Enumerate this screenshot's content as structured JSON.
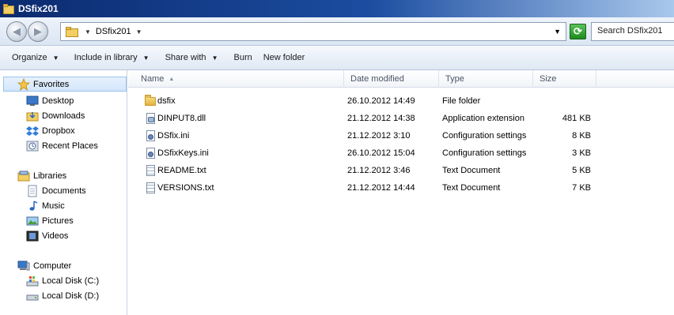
{
  "window": {
    "title": "DSfix201"
  },
  "address": {
    "path": "DSfix201",
    "search_placeholder": "Search DSfix201"
  },
  "toolbar": {
    "organize": "Organize",
    "include_in_library": "Include in library",
    "share_with": "Share with",
    "burn": "Burn",
    "new_folder": "New folder"
  },
  "nav": {
    "favorites": "Favorites",
    "desktop": "Desktop",
    "downloads": "Downloads",
    "dropbox": "Dropbox",
    "recent_places": "Recent Places",
    "libraries": "Libraries",
    "documents": "Documents",
    "music": "Music",
    "pictures": "Pictures",
    "videos": "Videos",
    "computer": "Computer",
    "local_disk_c": "Local Disk (C:)",
    "local_disk_d": "Local Disk (D:)"
  },
  "columns": {
    "name": "Name",
    "date_modified": "Date modified",
    "type": "Type",
    "size": "Size"
  },
  "files": [
    {
      "name": "dsfix",
      "date": "26.10.2012 14:49",
      "type": "File folder",
      "size": "",
      "icon": "folder-icon"
    },
    {
      "name": "DINPUT8.dll",
      "date": "21.12.2012 14:38",
      "type": "Application extension",
      "size": "481 KB",
      "icon": "dll-file-icon"
    },
    {
      "name": "DSfix.ini",
      "date": "21.12.2012 3:10",
      "type": "Configuration settings",
      "size": "8 KB",
      "icon": "ini-file-icon"
    },
    {
      "name": "DSfixKeys.ini",
      "date": "26.10.2012 15:04",
      "type": "Configuration settings",
      "size": "3 KB",
      "icon": "ini-file-icon"
    },
    {
      "name": "README.txt",
      "date": "21.12.2012 3:46",
      "type": "Text Document",
      "size": "5 KB",
      "icon": "text-file-icon"
    },
    {
      "name": "VERSIONS.txt",
      "date": "21.12.2012 14:44",
      "type": "Text Document",
      "size": "7 KB",
      "icon": "text-file-icon"
    }
  ]
}
